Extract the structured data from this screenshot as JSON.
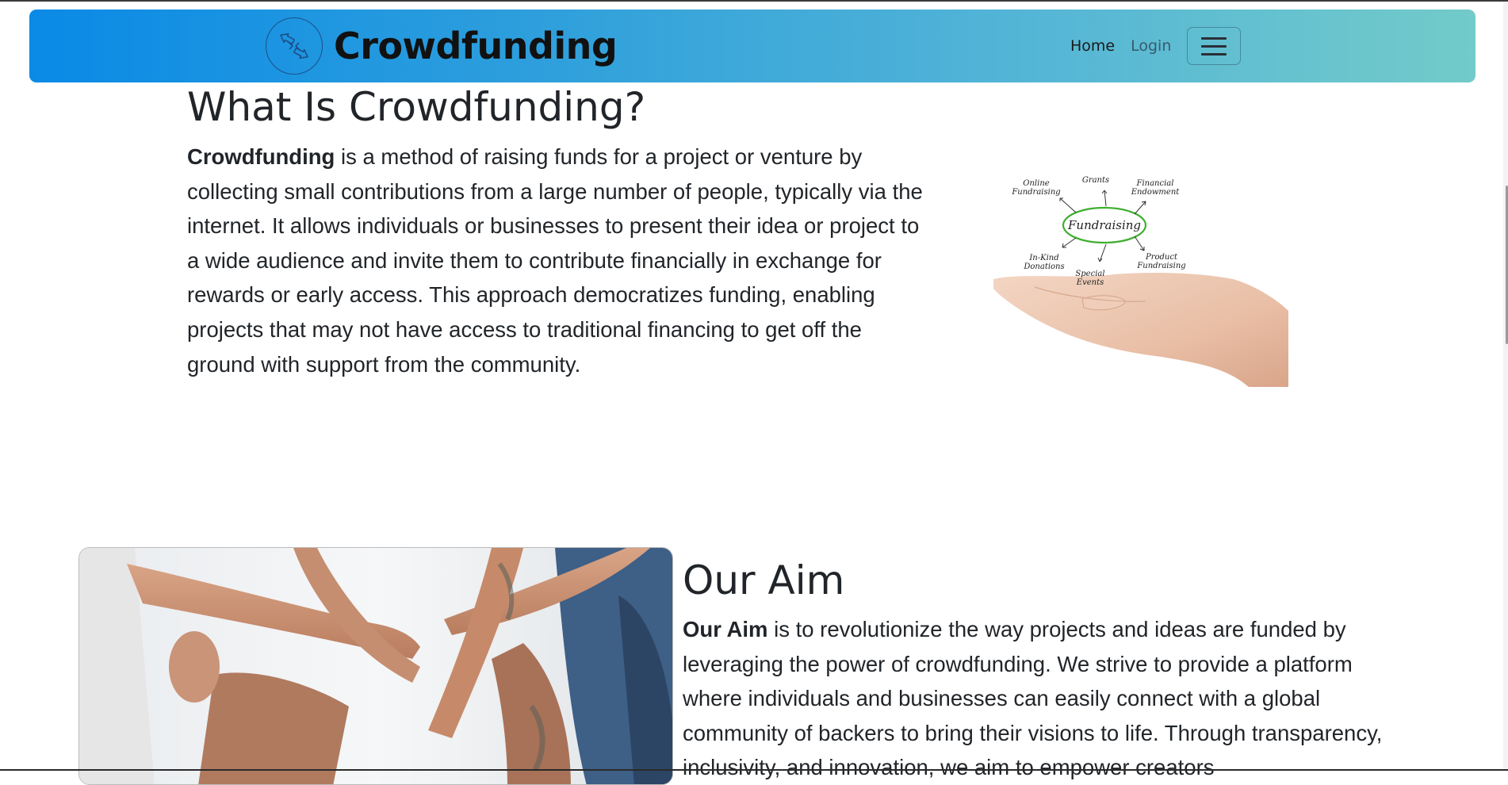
{
  "navbar": {
    "brand": "Crowdfunding",
    "links": [
      "Home",
      "Login"
    ],
    "logo_icon": "arrows-exchange-icon",
    "menu_icon": "hamburger-icon",
    "gradient_start": "#0a8ae6",
    "gradient_end": "#72cbc9"
  },
  "section_what": {
    "title": "What Is Crowdfunding?",
    "lead_bold": "Crowdfunding",
    "body": " is a method of raising funds for a project or venture by collecting small contributions from a large number of people, typically via the internet. It allows individuals or businesses to present their idea or project to a wide audience and invite them to contribute financially in exchange for rewards or early access. This approach democratizes funding, enabling projects that may not have access to traditional financing to get off the ground with support from the community.",
    "image": {
      "center_label": "Fundraising",
      "labels": [
        "Online Fundraising",
        "Grants",
        "Financial Endowment",
        "In-Kind Donations",
        "Special Events",
        "Product Fundraising"
      ]
    }
  },
  "section_aim": {
    "title": "Our Aim",
    "lead_bold": "Our Aim",
    "body": " is to revolutionize the way projects and ideas are funded by leveraging the power of crowdfunding. We strive to provide a platform where individuals and businesses can easily connect with a global community of backers to bring their visions to life. Through transparency, inclusivity, and innovation, we aim to empower creators"
  }
}
